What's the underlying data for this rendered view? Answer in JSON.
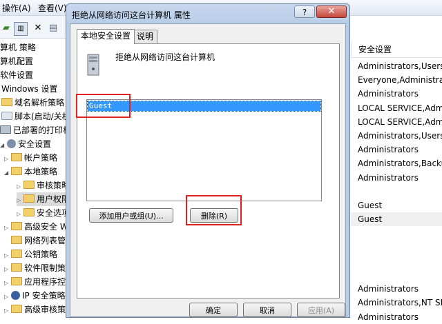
{
  "menubar": {
    "items": [
      "操作(A)",
      "查看(V)"
    ]
  },
  "tree": {
    "items": [
      "算机 策略",
      "算机配置",
      "软件设置",
      "Windows 设置",
      "域名解析策略",
      "脚本(启动/关机",
      "已部署的打印机",
      "安全设置",
      "帐户策略",
      "本地策略",
      "审核策略",
      "用户权限",
      "安全选项",
      "高级安全 W",
      "网络列表管",
      "公钥策略",
      "软件限制策",
      "应用程序控",
      "IP 安全策略",
      "高级审核策"
    ]
  },
  "right_pane": {
    "header": "安全设置",
    "rows": [
      "Administrators,Users",
      "Everyone,Administrat...",
      "Administrators",
      "LOCAL SERVICE,Admi...",
      "LOCAL SERVICE,Admi...",
      "Administrators,Users,...",
      "Administrators",
      "Administrators,Backu...",
      "Administrators",
      "",
      "Guest",
      "Guest",
      "",
      "",
      "",
      "",
      "Administrators",
      "Administrators,NT SE...",
      "Administrators"
    ]
  },
  "dialog": {
    "title": "拒绝从网络访问这台计算机 属性",
    "help_label": "?",
    "close_label": "✕",
    "tabs": [
      "本地安全设置",
      "说明"
    ],
    "policy_heading": "拒绝从网络访问这台计算机",
    "list_items": [
      "Guest"
    ],
    "add_label": "添加用户或组(U)...",
    "remove_label": "删除(R)",
    "ok_label": "确定",
    "cancel_label": "取消",
    "apply_label": "应用(A)"
  },
  "colors": {
    "selection": "#3399ff",
    "highlight_box": "#e02020",
    "title_bar": "#b9cde6"
  }
}
